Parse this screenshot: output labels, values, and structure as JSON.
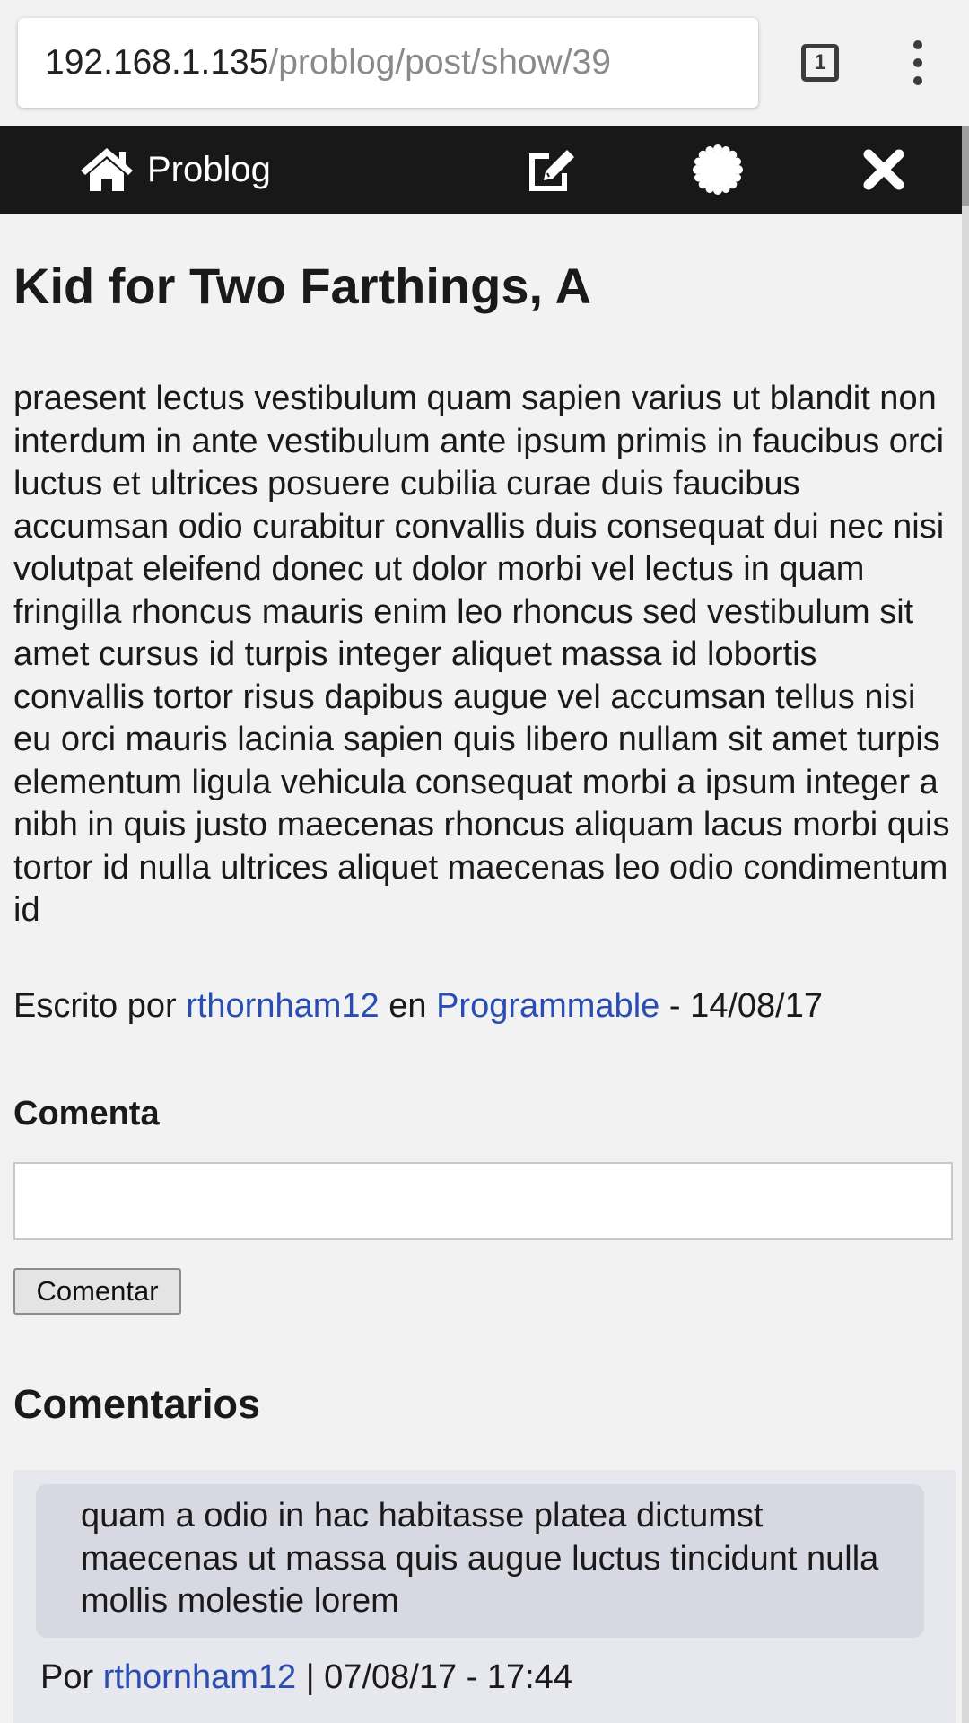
{
  "browser": {
    "url_host": "192.168.1.135",
    "url_path": "/problog/post/show/39",
    "tab_count": "1",
    "tabs_icon": "tab-switcher-icon",
    "menu_icon": "more-vert-icon"
  },
  "nav": {
    "brand": "Problog",
    "home_icon": "home-icon",
    "edit_icon": "edit-icon",
    "settings_icon": "gear-icon",
    "close_icon": "close-icon"
  },
  "post": {
    "title": "Kid for Two Farthings, A",
    "body": "praesent lectus vestibulum quam sapien varius ut blandit non interdum in ante vestibulum ante ipsum primis in faucibus orci luctus et ultrices posuere cubilia curae duis faucibus accumsan odio curabitur convallis duis consequat dui nec nisi volutpat eleifend donec ut dolor morbi vel lectus in quam fringilla rhoncus mauris enim leo rhoncus sed vestibulum sit amet cursus id turpis integer aliquet massa id lobortis convallis tortor risus dapibus augue vel accumsan tellus nisi eu orci mauris lacinia sapien quis libero nullam sit amet turpis elementum ligula vehicula consequat morbi a ipsum integer a nibh in quis justo maecenas rhoncus aliquam lacus morbi quis tortor id nulla ultrices aliquet maecenas leo odio condimentum id",
    "written_by_label": "Escrito por",
    "author": "rthornham12",
    "in_label": "en",
    "category": "Programmable",
    "date_sep": "-",
    "date": "14/08/17"
  },
  "comment_form": {
    "heading": "Comenta",
    "input_value": "",
    "submit_label": "Comentar"
  },
  "comments": {
    "heading": "Comentarios",
    "items": [
      {
        "text": "quam a odio in hac habitasse platea dictumst maecenas ut massa quis augue luctus tincidunt nulla mollis molestie lorem",
        "by_label": "Por",
        "author": "rthornham12",
        "separator": "|",
        "datetime": "07/08/17 - 17:44"
      }
    ]
  },
  "colors": {
    "navbar": "#181818",
    "link": "#2a4db3",
    "background": "#f2f2f2",
    "comment_panel": "#e7e7ee",
    "comment_bubble": "#d8d8e3"
  }
}
